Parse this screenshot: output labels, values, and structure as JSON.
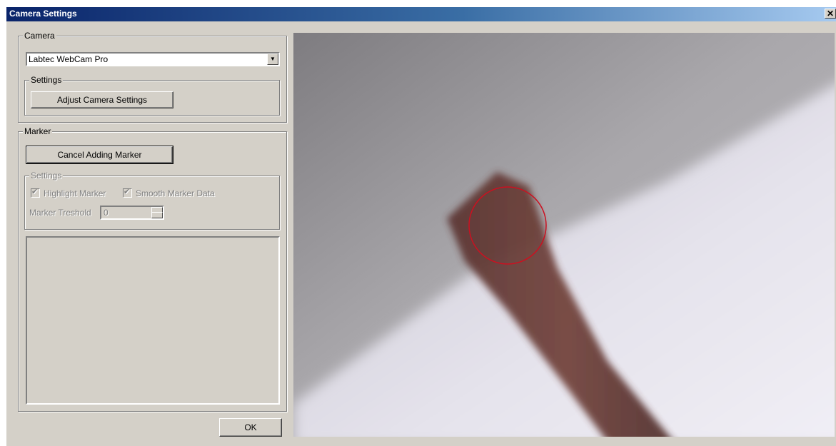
{
  "window": {
    "title": "Camera Settings",
    "close_glyph": "✕"
  },
  "camera_group": {
    "label": "Camera",
    "device_select": {
      "value": "Labtec WebCam Pro"
    },
    "settings_group": {
      "label": "Settings",
      "adjust_button": "Adjust Camera Settings"
    }
  },
  "marker_group": {
    "label": "Marker",
    "cancel_button": "Cancel Adding Marker",
    "settings_group": {
      "label": "Settings",
      "highlight_marker": {
        "label": "Highlight Marker",
        "checked": true
      },
      "smooth_marker_data": {
        "label": "Smooth Marker Data",
        "checked": true
      },
      "threshold": {
        "label": "Marker Treshold",
        "value": "0"
      }
    }
  },
  "ok_button": "OK",
  "video": {
    "marker_circle_color": "#cc1020"
  }
}
